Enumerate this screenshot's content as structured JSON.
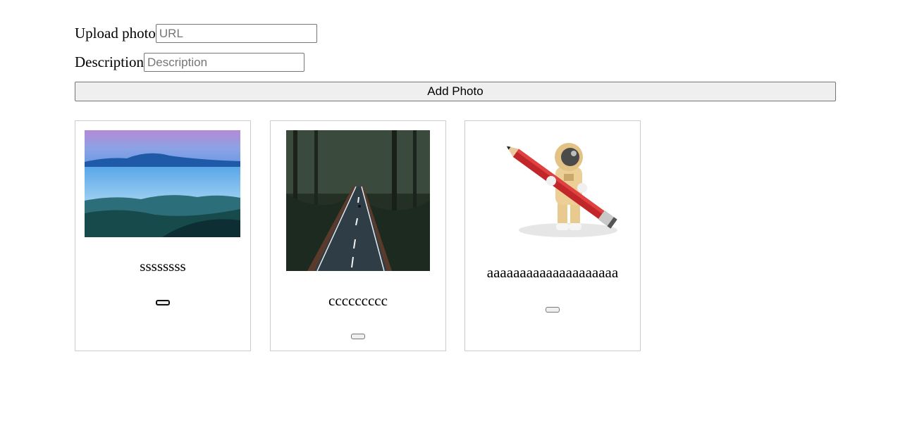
{
  "form": {
    "url_label": "Upload photo",
    "url_placeholder": "URL",
    "url_value": "",
    "description_label": "Description",
    "description_placeholder": "Description",
    "description_value": "",
    "add_button_label": "Add Photo"
  },
  "photos": [
    {
      "description": "ssssssss",
      "image": "misty-mountain-landscape"
    },
    {
      "description": "ccccccccc",
      "image": "forest-road"
    },
    {
      "description": "aaaaaaaaaaaaaaaaaaaa",
      "image": "astronaut-with-pencil"
    }
  ]
}
